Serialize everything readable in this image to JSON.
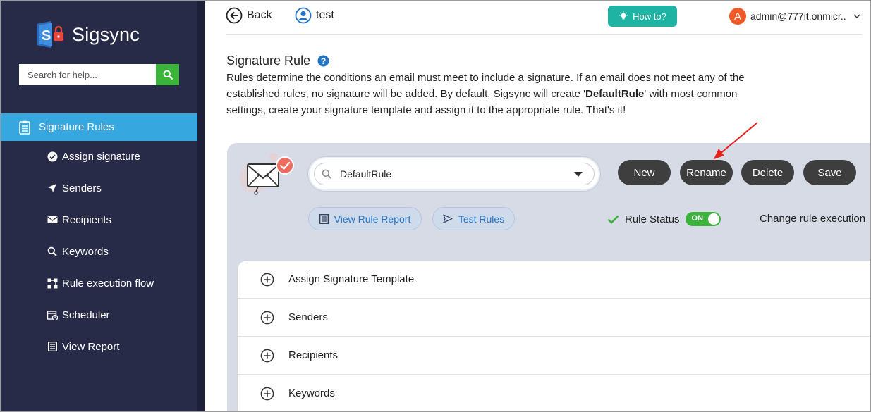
{
  "brand": {
    "name": "Sigsync"
  },
  "sidebar": {
    "search_placeholder": "Search for help...",
    "active_item": "Signature Rules",
    "items": [
      {
        "label": "Assign signature",
        "icon": "check-circle-icon"
      },
      {
        "label": "Senders",
        "icon": "paper-plane-icon"
      },
      {
        "label": "Recipients",
        "icon": "envelope-icon"
      },
      {
        "label": "Keywords",
        "icon": "magnifier-icon"
      },
      {
        "label": "Rule execution flow",
        "icon": "flow-icon"
      },
      {
        "label": "Scheduler",
        "icon": "calendar-icon"
      },
      {
        "label": "View Report",
        "icon": "report-icon"
      }
    ]
  },
  "header": {
    "back_label": "Back",
    "user_label": "test",
    "howto_label": "How to?",
    "account_initial": "A",
    "account_email": "admin@777it.onmicr.."
  },
  "page": {
    "title": "Signature Rule",
    "desc_part1": "Rules determine the conditions an email must meet to include a signature. If an email does not meet any of the established rules, no signature will be added. By default, Sigsync will create '",
    "desc_bold": "DefaultRule",
    "desc_part2": "' with most common settings, create your signature template and assign it to the appropriate rule. That's it!"
  },
  "rule": {
    "selected": "DefaultRule",
    "buttons": {
      "new": "New",
      "rename": "Rename",
      "delete": "Delete",
      "save": "Save"
    },
    "view_report": "View Rule Report",
    "test_rules": "Test Rules",
    "status_label": "Rule Status",
    "toggle_label": "ON",
    "change_exec": "Change rule execution"
  },
  "accordion": [
    {
      "label": "Assign Signature Template"
    },
    {
      "label": "Senders"
    },
    {
      "label": "Recipients"
    },
    {
      "label": "Keywords"
    }
  ],
  "colors": {
    "sidebar_bg": "#272b47",
    "active_nav": "#37a7e0",
    "search_green": "#3cb43c",
    "teal": "#1fb3a4",
    "pill_dark": "#3e3e3e",
    "link_blue": "#2474c6",
    "annotation_red": "#e8201c"
  }
}
